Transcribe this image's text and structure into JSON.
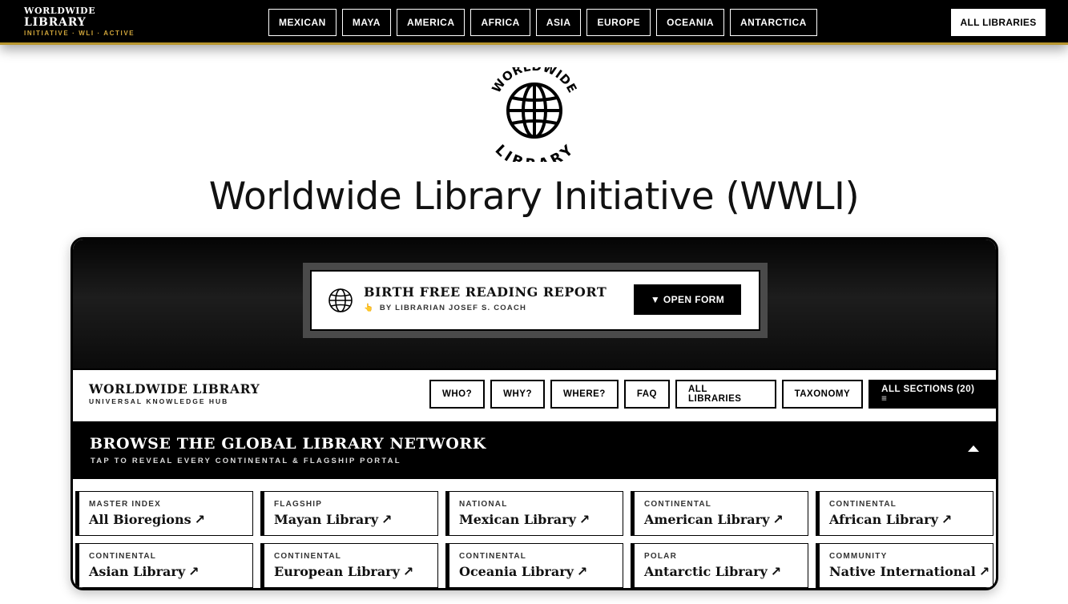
{
  "topbar": {
    "brand_line1": "WORLDWIDE",
    "brand_line2": "LIBRARY",
    "brand_tag": "INITIATIVE · WLI · ACTIVE",
    "nav": [
      "MEXICAN",
      "MAYA",
      "AMERICA",
      "AFRICA",
      "ASIA",
      "EUROPE",
      "OCEANIA",
      "ANTARCTICA"
    ],
    "all_libraries": "ALL LIBRARIES"
  },
  "logo": {
    "top_text": "WORLDWIDE",
    "bottom_text": "LIBRARY",
    "icon": "globe-icon"
  },
  "page": {
    "title": "Worldwide Library Initiative (WWLI)"
  },
  "promo": {
    "icon": "globe-icon",
    "title": "BIRTH FREE READING REPORT",
    "hand_icon": "👆",
    "subtitle": "BY LIBRARIAN JOSEF S. COACH",
    "button": "▼ OPEN FORM"
  },
  "subnav": {
    "brand_title": "WORLDWIDE LIBRARY",
    "brand_tag": "UNIVERSAL KNOWLEDGE HUB",
    "buttons": [
      "WHO?",
      "WHY?",
      "WHERE?",
      "FAQ",
      "ALL LIBRARIES",
      "TAXONOMY"
    ],
    "all_sections": "ALL SECTIONS (20) ≡"
  },
  "browse": {
    "title": "BROWSE THE GLOBAL LIBRARY NETWORK",
    "subtitle": "TAP TO REVEAL EVERY CONTINENTAL & FLAGSHIP PORTAL"
  },
  "tiles": [
    {
      "category": "MASTER INDEX",
      "name": "All Bioregions"
    },
    {
      "category": "FLAGSHIP",
      "name": "Mayan Library"
    },
    {
      "category": "NATIONAL",
      "name": "Mexican Library"
    },
    {
      "category": "CONTINENTAL",
      "name": "American Library"
    },
    {
      "category": "CONTINENTAL",
      "name": "African Library"
    },
    {
      "category": "CONTINENTAL",
      "name": "Asian Library"
    },
    {
      "category": "CONTINENTAL",
      "name": "European Library"
    },
    {
      "category": "CONTINENTAL",
      "name": "Oceania Library"
    },
    {
      "category": "POLAR",
      "name": "Antarctic Library"
    },
    {
      "category": "COMMUNITY",
      "name": "Native International"
    }
  ],
  "arrow": "↗"
}
